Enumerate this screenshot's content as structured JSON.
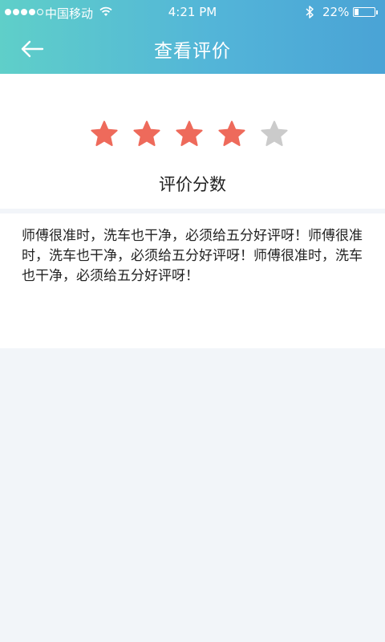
{
  "status_bar": {
    "carrier": "中国移动",
    "time": "4:21 PM",
    "battery_text": "22%",
    "battery_level": 0.22,
    "signal": {
      "filled": 4,
      "total": 5
    }
  },
  "nav": {
    "title": "查看评价",
    "back_icon": "arrow-left-icon"
  },
  "rating": {
    "value": 4,
    "max": 5,
    "label": "评价分数",
    "active_color": "#ee6a5b",
    "inactive_color": "#cbcbcb"
  },
  "review": {
    "text": "师傅很准时，洗车也干净，必须给五分好评呀！师傅很准时，洗车也干净，必须给五分好评呀！师傅很准时，洗车也干净，必须给五分好评呀！"
  },
  "colors": {
    "header_gradient_start": "#5fcfc9",
    "header_gradient_end": "#4aa3d6",
    "page_background": "#f2f5f9"
  }
}
